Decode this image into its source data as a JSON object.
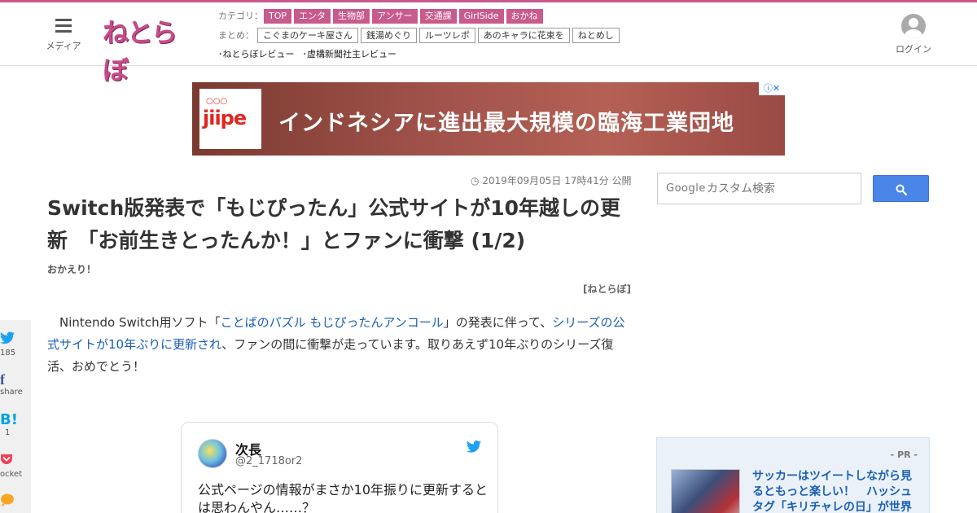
{
  "header": {
    "menu_label": "メディア",
    "logo_text": "ねとらぼ",
    "category_prefix": "カテゴリ：",
    "categories": [
      "TOP",
      "エンタ",
      "生物部",
      "アンサー",
      "交通課",
      "GirlSide",
      "おかね"
    ],
    "summary_prefix": "まとめ：",
    "summaries": [
      "こぐまのケーキ屋さん",
      "銭湯めぐり",
      "ルーツレポ",
      "あのキャラに花束を",
      "ねとめし"
    ],
    "reviews": [
      "･ねとらぼレビュー",
      "･虚構新聞社主レビュー"
    ],
    "login_label": "ログイン"
  },
  "ad": {
    "brand": "jiipe",
    "headline": "インドネシアに進出最大規模の臨海工業団地"
  },
  "article": {
    "date": "2019年09月05日 17時41分 公開",
    "title": "Switch版発表で「もじぴったん」公式サイトが10年越しの更新　「お前生きとったんか！」とファンに衝撃 (1/2)",
    "subtitle": "おかえり！",
    "source": "[ねとらぼ]",
    "body_1": "Nintendo Switch用ソフト「",
    "link_1": "ことばのパズル もじぴったんアンコール",
    "body_2": "」の発表に伴って、",
    "link_2": "シリーズの公式サイトが10年ぶりに更新され",
    "body_3": "、ファンの間に衝撃が走っています。取りあえず10年ぶりのシリーズ復活、おめでとう！"
  },
  "share": {
    "twitter_count": "185",
    "facebook_label": "share",
    "hatena_icon_text": "B!",
    "hatena_count": "1",
    "pocket_label": "ocket"
  },
  "tweet": {
    "name": "次長",
    "handle": "@2_1718or2",
    "text": "公式ページの情報がまさか10年振りに更新するとは思わんやん……？"
  },
  "sidebar": {
    "search_brand": "Google",
    "search_placeholder": "カスタム検索",
    "pr_label": "- PR -",
    "pr_title": "サッカーはツイートしながら見るともっと楽しい！　ハッシュタグ「キリチャレの日」が世界"
  },
  "colors": {
    "brand_pink": "#c85a8e",
    "link_blue": "#1a5fb4",
    "search_button": "#4a86e8"
  }
}
